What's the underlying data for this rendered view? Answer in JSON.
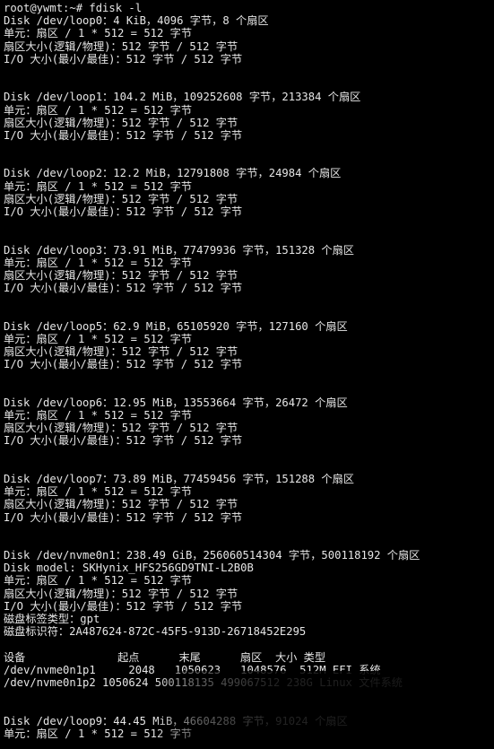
{
  "terminal": {
    "lines": [
      "root@ywmt:~# fdisk -l",
      "Disk /dev/loop0：4 KiB，4096 字节，8 个扇区",
      "单元：扇区 / 1 * 512 = 512 字节",
      "扇区大小(逻辑/物理)：512 字节 / 512 字节",
      "I/O 大小(最小/最佳)：512 字节 / 512 字节",
      "",
      "",
      "Disk /dev/loop1：104.2 MiB，109252608 字节，213384 个扇区",
      "单元：扇区 / 1 * 512 = 512 字节",
      "扇区大小(逻辑/物理)：512 字节 / 512 字节",
      "I/O 大小(最小/最佳)：512 字节 / 512 字节",
      "",
      "",
      "Disk /dev/loop2：12.2 MiB，12791808 字节，24984 个扇区",
      "单元：扇区 / 1 * 512 = 512 字节",
      "扇区大小(逻辑/物理)：512 字节 / 512 字节",
      "I/O 大小(最小/最佳)：512 字节 / 512 字节",
      "",
      "",
      "Disk /dev/loop3：73.91 MiB，77479936 字节，151328 个扇区",
      "单元：扇区 / 1 * 512 = 512 字节",
      "扇区大小(逻辑/物理)：512 字节 / 512 字节",
      "I/O 大小(最小/最佳)：512 字节 / 512 字节",
      "",
      "",
      "Disk /dev/loop5：62.9 MiB，65105920 字节，127160 个扇区",
      "单元：扇区 / 1 * 512 = 512 字节",
      "扇区大小(逻辑/物理)：512 字节 / 512 字节",
      "I/O 大小(最小/最佳)：512 字节 / 512 字节",
      "",
      "",
      "Disk /dev/loop6：12.95 MiB，13553664 字节，26472 个扇区",
      "单元：扇区 / 1 * 512 = 512 字节",
      "扇区大小(逻辑/物理)：512 字节 / 512 字节",
      "I/O 大小(最小/最佳)：512 字节 / 512 字节",
      "",
      "",
      "Disk /dev/loop7：73.89 MiB，77459456 字节，151288 个扇区",
      "单元：扇区 / 1 * 512 = 512 字节",
      "扇区大小(逻辑/物理)：512 字节 / 512 字节",
      "I/O 大小(最小/最佳)：512 字节 / 512 字节",
      "",
      "",
      "Disk /dev/nvme0n1：238.49 GiB，256060514304 字节，500118192 个扇区",
      "Disk model: SKHynix_HFS256GD9TNI-L2B0B",
      "单元：扇区 / 1 * 512 = 512 字节",
      "扇区大小(逻辑/物理)：512 字节 / 512 字节",
      "I/O 大小(最小/最佳)：512 字节 / 512 字节",
      "磁盘标签类型：gpt",
      "磁盘标识符：2A487624-872C-45F5-913D-26718452E295",
      "",
      "设备              起点      末尾      扇区  大小 类型",
      "/dev/nvme0n1p1     2048   1050623   1048576  512M EFI 系统",
      "/dev/nvme0n1p2 1050624 500118135 499067512 238G Linux 文件系统",
      "",
      "",
      "Disk /dev/loop9：44.45 MiB，46604288 字节，91024 个扇区",
      "单元：扇区 / 1 * 512 = 512 字节"
    ]
  }
}
